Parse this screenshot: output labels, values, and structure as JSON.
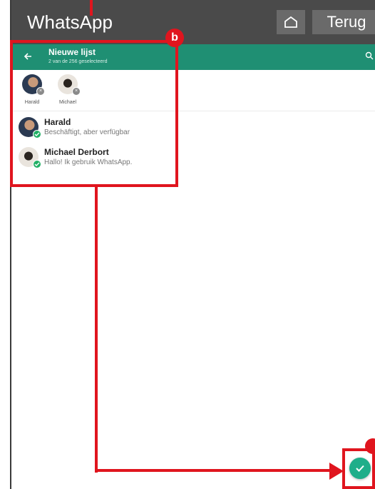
{
  "topbar": {
    "app_name": "WhatsApp",
    "home_icon": "home-icon",
    "back_label": "Terug"
  },
  "header": {
    "title": "Nieuwe lijst",
    "subtitle": "2 van de 256 geselecteerd",
    "back_icon": "arrow-left-icon",
    "search_icon": "search-icon",
    "color": "#1f8f73"
  },
  "selected": [
    {
      "label": "Harald"
    },
    {
      "label": "Michael"
    }
  ],
  "contacts": [
    {
      "name": "Harald",
      "status": "Beschäftigt, aber verfügbar"
    },
    {
      "name": "Michael Derbort",
      "status": "Hallo! Ik gebruik WhatsApp."
    }
  ],
  "annotation": {
    "badge": "b",
    "color": "#e0151e"
  },
  "fab": {
    "icon": "check-icon",
    "color": "#1fae8a"
  }
}
